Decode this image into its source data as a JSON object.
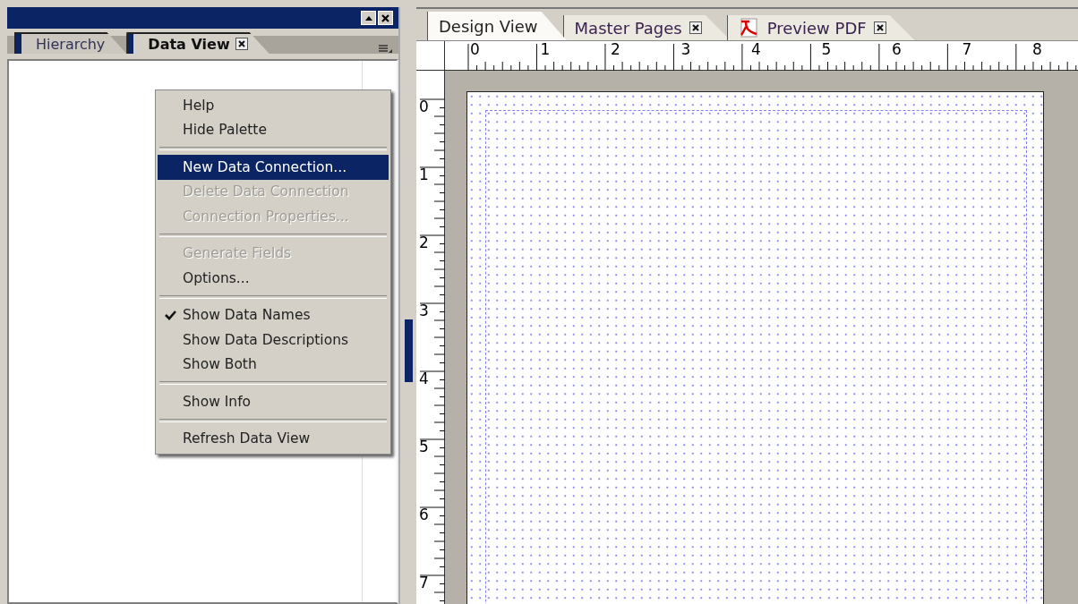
{
  "palette": {
    "tabs": [
      {
        "label": "Hierarchy",
        "selected": false,
        "closable": false
      },
      {
        "label": "Data View",
        "selected": true,
        "closable": true
      }
    ]
  },
  "context_menu": {
    "items": [
      {
        "kind": "item",
        "label": "Help",
        "disabled": false,
        "selected": false,
        "checked": false
      },
      {
        "kind": "item",
        "label": "Hide Palette",
        "disabled": false,
        "selected": false,
        "checked": false
      },
      {
        "kind": "separator"
      },
      {
        "kind": "item",
        "label": "New Data Connection...",
        "disabled": false,
        "selected": true,
        "checked": false
      },
      {
        "kind": "item",
        "label": "Delete Data Connection",
        "disabled": true,
        "selected": false,
        "checked": false
      },
      {
        "kind": "item",
        "label": "Connection Properties...",
        "disabled": true,
        "selected": false,
        "checked": false
      },
      {
        "kind": "separator"
      },
      {
        "kind": "item",
        "label": "Generate Fields",
        "disabled": true,
        "selected": false,
        "checked": false
      },
      {
        "kind": "item",
        "label": "Options...",
        "disabled": false,
        "selected": false,
        "checked": false
      },
      {
        "kind": "separator"
      },
      {
        "kind": "item",
        "label": "Show Data Names",
        "disabled": false,
        "selected": false,
        "checked": true
      },
      {
        "kind": "item",
        "label": "Show Data Descriptions",
        "disabled": false,
        "selected": false,
        "checked": false
      },
      {
        "kind": "item",
        "label": "Show Both",
        "disabled": false,
        "selected": false,
        "checked": false
      },
      {
        "kind": "separator"
      },
      {
        "kind": "item",
        "label": "Show Info",
        "disabled": false,
        "selected": false,
        "checked": false
      },
      {
        "kind": "separator"
      },
      {
        "kind": "item",
        "label": "Refresh Data View",
        "disabled": false,
        "selected": false,
        "checked": false
      }
    ]
  },
  "editor": {
    "tabs": [
      {
        "label": "Design View",
        "selected": true,
        "closable": false,
        "kind": "plain"
      },
      {
        "label": "Master Pages",
        "selected": false,
        "closable": true,
        "kind": "plain"
      },
      {
        "label": "Preview PDF",
        "selected": false,
        "closable": true,
        "kind": "pdf"
      }
    ],
    "horizontal_ruler": [
      "0",
      "1",
      "2",
      "3",
      "4",
      "5",
      "6",
      "7",
      "8"
    ],
    "vertical_ruler": [
      "0",
      "1",
      "2",
      "3",
      "4",
      "5",
      "6",
      "7"
    ]
  }
}
